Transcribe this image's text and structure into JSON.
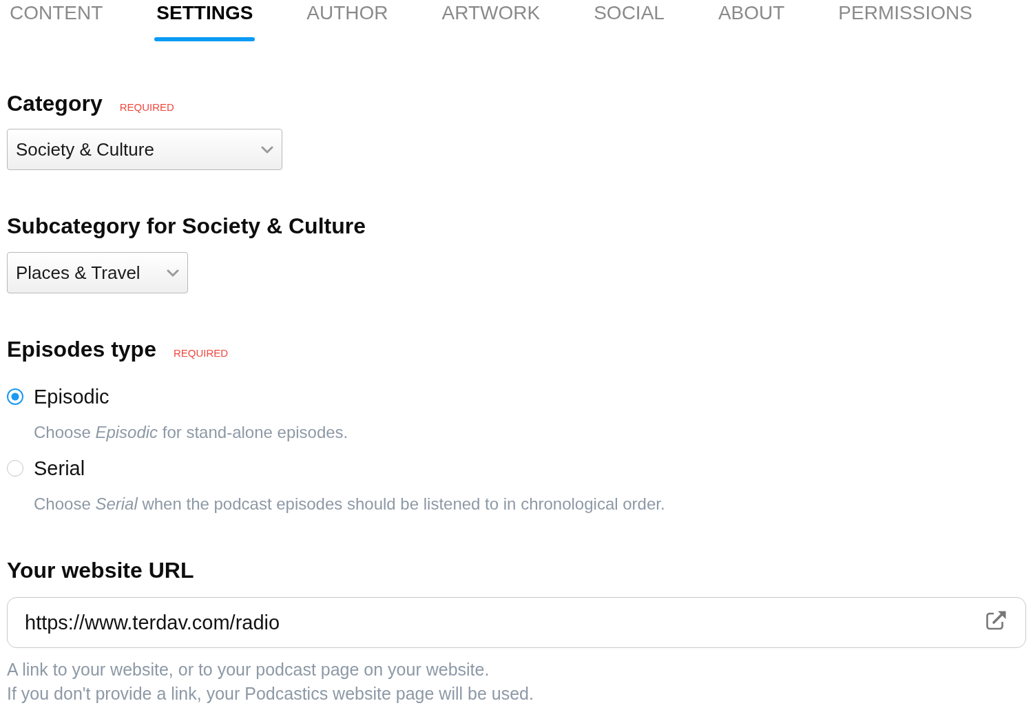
{
  "tabs": [
    {
      "label": "CONTENT",
      "selected": false
    },
    {
      "label": "SETTINGS",
      "selected": true
    },
    {
      "label": "AUTHOR",
      "selected": false
    },
    {
      "label": "ARTWORK",
      "selected": false
    },
    {
      "label": "SOCIAL",
      "selected": false
    },
    {
      "label": "ABOUT",
      "selected": false
    },
    {
      "label": "PERMISSIONS",
      "selected": false
    }
  ],
  "category": {
    "label": "Category",
    "note": "REQUIRED",
    "value": "Society & Culture"
  },
  "subcategory": {
    "label": "Subcategory for Society & Culture",
    "value": "Places & Travel"
  },
  "episodes_type": {
    "label": "Episodes type",
    "note": "REQUIRED",
    "options": [
      {
        "label": "Episodic",
        "selected": true,
        "description": "Choose *Episodic* for stand-alone episodes."
      },
      {
        "label": "Serial",
        "selected": false,
        "description": "Choose *Serial* when the podcast episodes should be listened to in chronological order."
      }
    ]
  },
  "website_url": {
    "label": "Your website URL",
    "value": "https://www.terdav.com/radio",
    "help": [
      "A link to your website, or to your podcast page on your website.",
      "If you don't provide a link, your Podcastics website page will be used."
    ]
  }
}
